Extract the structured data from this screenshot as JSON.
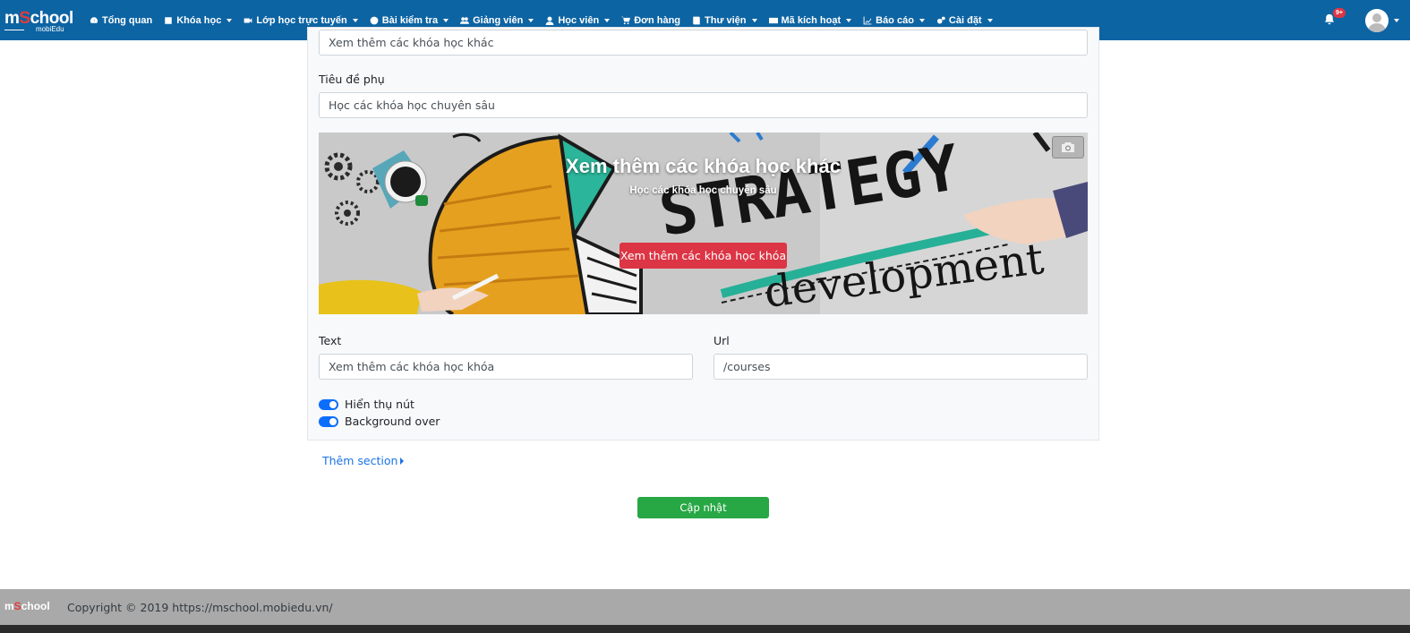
{
  "brand": {
    "name_prefix": "m",
    "name_s": "S",
    "name_suffix": "chool",
    "sub": "mobiEdu"
  },
  "nav": {
    "items": [
      {
        "label": "Tổng quan",
        "icon": "dashboard-icon",
        "caret": false
      },
      {
        "label": "Khóa học",
        "icon": "book-icon",
        "caret": true
      },
      {
        "label": "Lớp học trực tuyến",
        "icon": "video-icon",
        "caret": true
      },
      {
        "label": "Bài kiểm tra",
        "icon": "question-icon",
        "caret": true
      },
      {
        "label": "Giảng viên",
        "icon": "users-icon",
        "caret": true
      },
      {
        "label": "Học viên",
        "icon": "user-icon",
        "caret": true
      },
      {
        "label": "Đơn hàng",
        "icon": "cart-icon",
        "caret": false
      },
      {
        "label": "Thư viện",
        "icon": "library-icon",
        "caret": true
      },
      {
        "label": "Mã kích hoạt",
        "icon": "card-icon",
        "caret": true
      },
      {
        "label": "Báo cáo",
        "icon": "chart-icon",
        "caret": true
      },
      {
        "label": "Cài đặt",
        "icon": "cogs-icon",
        "caret": true
      }
    ],
    "notifications_badge": "9+"
  },
  "form": {
    "title_value": "Xem thêm các khóa học khác",
    "subtitle_label": "Tiêu đề phụ",
    "subtitle_value": "Học các khóa học chuyên sâu",
    "text_label": "Text",
    "text_value": "Xem thêm các khóa học khóa",
    "url_label": "Url",
    "url_value": "/courses",
    "toggle_show_button": "Hiển thụ nút",
    "toggle_background": "Background over"
  },
  "banner": {
    "title": "Xem thêm các khóa học khác",
    "subtitle": "Học các khóa học chuyên sâu",
    "button_label": "Xem thêm các khóa học khóa",
    "image_words": {
      "strategy": "STRATEGY",
      "development": "development"
    }
  },
  "actions": {
    "add_section": "Thêm section",
    "update": "Cập nhật"
  },
  "footer": {
    "logo_prefix": "m",
    "logo_s": "S",
    "logo_suffix": "chool",
    "copyright": "Copyright © 2019 https://mschool.mobiedu.vn/"
  },
  "colors": {
    "navbar": "#0d64a3",
    "danger": "#dc3545",
    "success": "#28a745",
    "link": "#1a73e8",
    "toggle": "#0d6efd"
  }
}
